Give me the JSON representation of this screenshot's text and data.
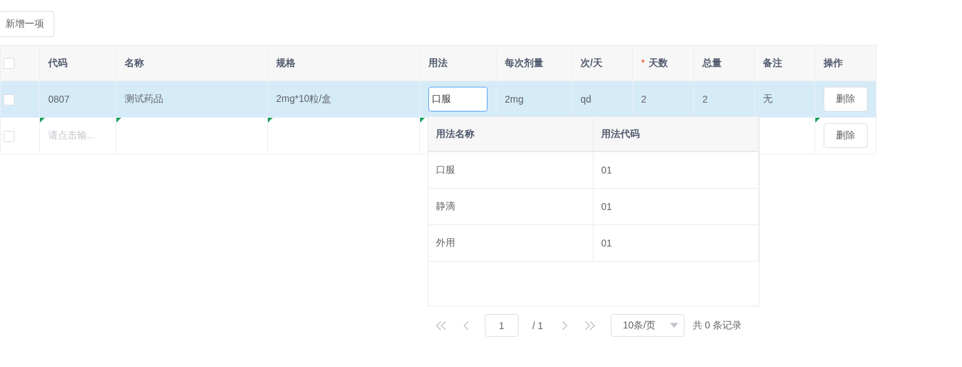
{
  "add_button": "新增一项",
  "select_all_checked": false,
  "required_mark": "*",
  "columns": [
    {
      "label": "代码",
      "required": false
    },
    {
      "label": "名称",
      "required": false
    },
    {
      "label": "规格",
      "required": false
    },
    {
      "label": "用法",
      "required": false
    },
    {
      "label": "每次剂量",
      "required": false
    },
    {
      "label": "次/天",
      "required": false
    },
    {
      "label": "天数",
      "required": true
    },
    {
      "label": "总量",
      "required": false
    },
    {
      "label": "备注",
      "required": false
    },
    {
      "label": "操作",
      "required": false
    }
  ],
  "rows": [
    {
      "selected": true,
      "checked": false,
      "modified": false,
      "cells": [
        {
          "kind": "text",
          "value": "0807"
        },
        {
          "kind": "text",
          "value": "测试药品"
        },
        {
          "kind": "text",
          "value": "2mg*10粒/盒"
        },
        {
          "kind": "input",
          "value": "口服"
        },
        {
          "kind": "text",
          "value": "2mg"
        },
        {
          "kind": "text",
          "value": "qd"
        },
        {
          "kind": "text",
          "value": "2"
        },
        {
          "kind": "text",
          "value": "2"
        },
        {
          "kind": "text",
          "value": "无"
        }
      ],
      "action": "删除"
    },
    {
      "selected": false,
      "checked": false,
      "modified": true,
      "cells": [
        {
          "kind": "placeholder",
          "value": "请点击输..."
        },
        {
          "kind": "empty"
        },
        {
          "kind": "empty"
        },
        {
          "kind": "empty"
        },
        {
          "kind": "empty"
        },
        {
          "kind": "empty"
        },
        {
          "kind": "empty"
        },
        {
          "kind": "empty"
        },
        {
          "kind": "empty"
        }
      ],
      "action": "删除"
    }
  ],
  "popup": {
    "columns": [
      "用法名称",
      "用法代码"
    ],
    "rows": [
      {
        "name": "口服",
        "code": "01"
      },
      {
        "name": "静滴",
        "code": "01"
      },
      {
        "name": "外用",
        "code": "01"
      }
    ],
    "pagination": {
      "page": "1",
      "total_pages": "/ 1",
      "page_size": "10条/页",
      "summary": "共 0 条记录"
    }
  }
}
